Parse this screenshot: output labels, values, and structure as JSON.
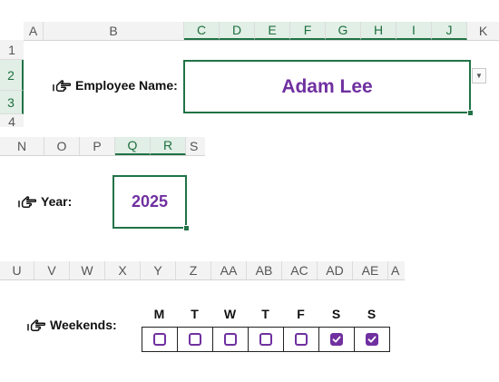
{
  "top_section": {
    "columns": [
      "A",
      "B",
      "C",
      "D",
      "E",
      "F",
      "G",
      "H",
      "I",
      "J",
      "K"
    ],
    "rows": [
      "1",
      "2",
      "3",
      "4"
    ],
    "label": "Employee Name:",
    "value": "Adam Lee"
  },
  "year_section": {
    "columns": [
      "N",
      "O",
      "P",
      "Q",
      "R",
      "S"
    ],
    "label": "Year:",
    "value": "2025"
  },
  "weekend_section": {
    "columns": [
      "U",
      "V",
      "W",
      "X",
      "Y",
      "Z",
      "AA",
      "AB",
      "AC",
      "AD",
      "AE",
      "A"
    ],
    "label": "Weekends:",
    "days": [
      {
        "letter": "M",
        "checked": false
      },
      {
        "letter": "T",
        "checked": false
      },
      {
        "letter": "W",
        "checked": false
      },
      {
        "letter": "T",
        "checked": false
      },
      {
        "letter": "F",
        "checked": false
      },
      {
        "letter": "S",
        "checked": true
      },
      {
        "letter": "S",
        "checked": true
      }
    ]
  },
  "colors": {
    "accent": "#7030a0",
    "selection": "#217346"
  }
}
